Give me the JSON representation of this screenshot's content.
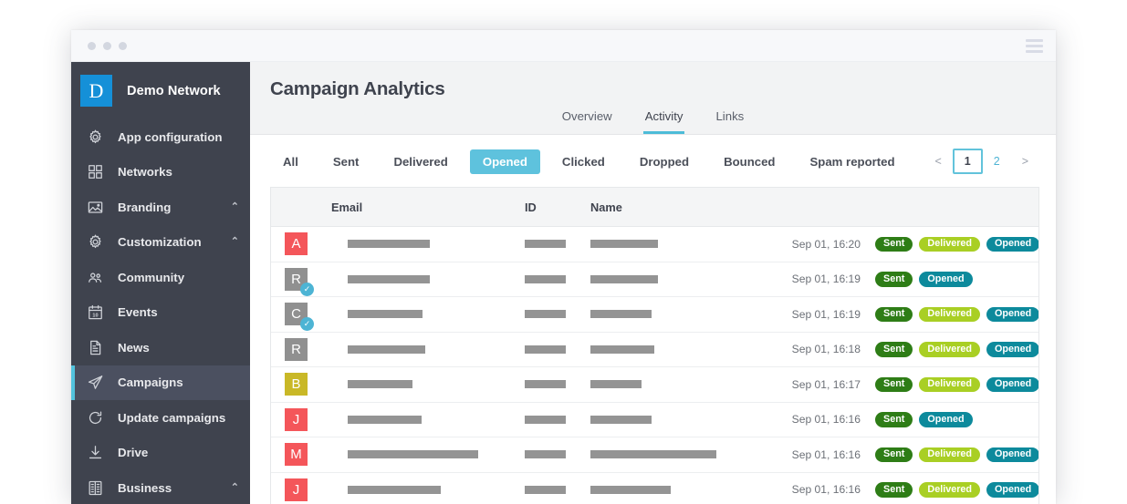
{
  "window": {
    "dots": [
      "dot-1",
      "dot-2",
      "dot-3"
    ],
    "menu_icon": "hamburger-icon"
  },
  "sidebar": {
    "brand": {
      "initial": "D",
      "name": "Demo Network",
      "logo_color": "#1590d8"
    },
    "items": [
      {
        "label": "App configuration",
        "icon": "gear-icon",
        "caret": "",
        "active": false
      },
      {
        "label": "Networks",
        "icon": "grid-icon",
        "caret": "",
        "active": false
      },
      {
        "label": "Branding",
        "icon": "image-icon",
        "caret": "⌃",
        "active": false
      },
      {
        "label": "Customization",
        "icon": "gear-icon",
        "caret": "⌃",
        "active": false
      },
      {
        "label": "Community",
        "icon": "people-icon",
        "caret": "",
        "active": false
      },
      {
        "label": "Events",
        "icon": "calendar-icon",
        "caret": "",
        "active": false
      },
      {
        "label": "News",
        "icon": "document-icon",
        "caret": "",
        "active": false
      },
      {
        "label": "Campaigns",
        "icon": "paper-plane-icon",
        "caret": "",
        "active": true
      },
      {
        "label": "Update campaigns",
        "icon": "refresh-icon",
        "caret": "",
        "active": false
      },
      {
        "label": "Drive",
        "icon": "download-icon",
        "caret": "",
        "active": false
      },
      {
        "label": "Business",
        "icon": "building-icon",
        "caret": "⌃",
        "active": false
      }
    ],
    "active_accent": "#53c3dd",
    "background": "#3f434e"
  },
  "header": {
    "title": "Campaign Analytics",
    "tabs": [
      {
        "label": "Overview",
        "active": false
      },
      {
        "label": "Activity",
        "active": true
      },
      {
        "label": "Links",
        "active": false
      }
    ],
    "tab_accent": "#4dbcd8"
  },
  "filters": {
    "chips": [
      {
        "label": "All",
        "active": false
      },
      {
        "label": "Sent",
        "active": false
      },
      {
        "label": "Delivered",
        "active": false
      },
      {
        "label": "Opened",
        "active": true
      },
      {
        "label": "Clicked",
        "active": false
      },
      {
        "label": "Dropped",
        "active": false
      },
      {
        "label": "Bounced",
        "active": false
      },
      {
        "label": "Spam reported",
        "active": false
      }
    ],
    "active_color": "#5ec2dd"
  },
  "pagination": {
    "prev": "<",
    "next": ">",
    "pages": [
      {
        "label": "1",
        "current": true
      },
      {
        "label": "2",
        "current": false
      }
    ]
  },
  "table": {
    "columns": [
      "",
      "Email",
      "ID",
      "Name",
      "",
      ""
    ],
    "headers": {
      "email": "Email",
      "id": "ID",
      "name": "Name"
    },
    "rows": [
      {
        "avatar": {
          "letter": "A",
          "color": "#f4565a",
          "verified": false
        },
        "email_width": 90,
        "id_width": 45,
        "name_width": 74,
        "time": "Sep 01, 16:20",
        "badges": [
          "Sent",
          "Delivered",
          "Opened"
        ]
      },
      {
        "avatar": {
          "letter": "R",
          "color": "#909090",
          "verified": true
        },
        "email_width": 90,
        "id_width": 45,
        "name_width": 74,
        "time": "Sep 01, 16:19",
        "badges": [
          "Sent",
          "Opened"
        ]
      },
      {
        "avatar": {
          "letter": "C",
          "color": "#909090",
          "verified": true
        },
        "email_width": 82,
        "id_width": 45,
        "name_width": 67,
        "time": "Sep 01, 16:19",
        "badges": [
          "Sent",
          "Delivered",
          "Opened"
        ]
      },
      {
        "avatar": {
          "letter": "R",
          "color": "#909090",
          "verified": false
        },
        "email_width": 85,
        "id_width": 45,
        "name_width": 70,
        "time": "Sep 01, 16:18",
        "badges": [
          "Sent",
          "Delivered",
          "Opened"
        ]
      },
      {
        "avatar": {
          "letter": "B",
          "color": "#c9b827",
          "verified": false
        },
        "email_width": 71,
        "id_width": 45,
        "name_width": 56,
        "time": "Sep 01, 16:17",
        "badges": [
          "Sent",
          "Delivered",
          "Opened"
        ]
      },
      {
        "avatar": {
          "letter": "J",
          "color": "#f4565a",
          "verified": false
        },
        "email_width": 81,
        "id_width": 45,
        "name_width": 67,
        "time": "Sep 01, 16:16",
        "badges": [
          "Sent",
          "Opened"
        ]
      },
      {
        "avatar": {
          "letter": "M",
          "color": "#f4565a",
          "verified": false
        },
        "email_width": 143,
        "id_width": 45,
        "name_width": 138,
        "time": "Sep 01, 16:16",
        "badges": [
          "Sent",
          "Delivered",
          "Opened"
        ]
      },
      {
        "avatar": {
          "letter": "J",
          "color": "#f4565a",
          "verified": false
        },
        "email_width": 102,
        "id_width": 45,
        "name_width": 88,
        "time": "Sep 01, 16:16",
        "badges": [
          "Sent",
          "Delivered",
          "Opened"
        ]
      }
    ],
    "badge_colors": {
      "Sent": "#2e7d16",
      "Delivered": "#a9cf24",
      "Opened": "#0d8a9c"
    }
  }
}
